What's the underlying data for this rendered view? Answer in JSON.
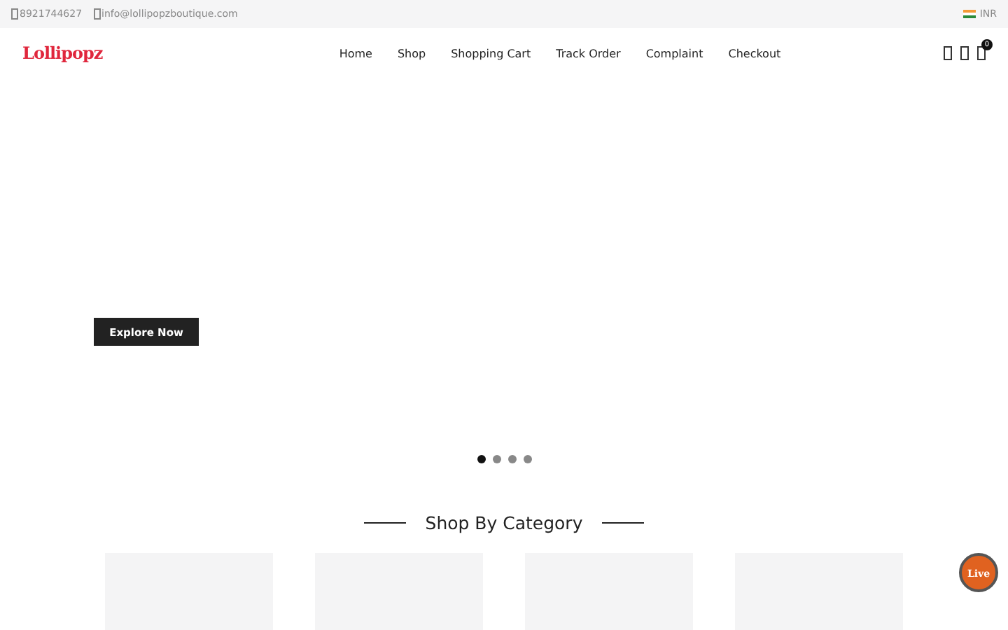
{
  "topbar": {
    "phone": "8921744627",
    "email": "info@lollipopzboutique.com",
    "currency": "INR"
  },
  "header": {
    "logo": "Lollipopz",
    "nav": [
      {
        "label": "Home"
      },
      {
        "label": "Shop"
      },
      {
        "label": "Shopping Cart"
      },
      {
        "label": "Track Order"
      },
      {
        "label": "Complaint"
      },
      {
        "label": "Checkout"
      }
    ],
    "cart_count": "0"
  },
  "hero": {
    "button": "Explore Now",
    "dots": [
      {
        "selected": true
      },
      {
        "selected": false
      },
      {
        "selected": false
      },
      {
        "selected": false
      }
    ]
  },
  "category": {
    "title": "Shop By Category"
  },
  "live_chat": {
    "label": "Live"
  }
}
